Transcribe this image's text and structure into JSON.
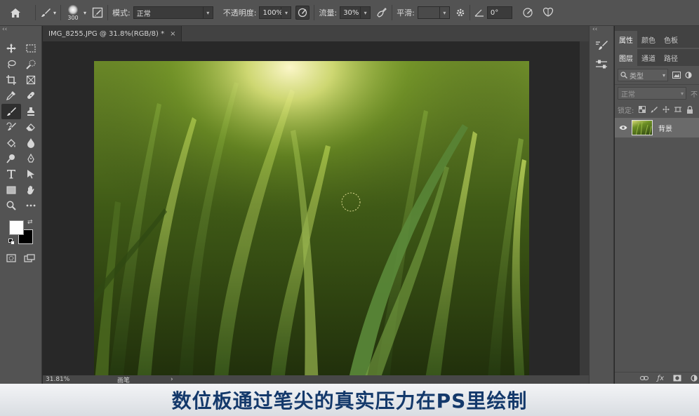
{
  "options_bar": {
    "brush_size": "300",
    "mode_label": "模式:",
    "mode_value": "正常",
    "opacity_label": "不透明度:",
    "opacity_value": "100%",
    "flow_label": "流量:",
    "flow_value": "30%",
    "smoothing_label": "平滑:",
    "angle_value": "0°"
  },
  "document": {
    "tab_title": "IMG_8255.JPG @ 31.8%(RGB/8) *",
    "close_glyph": "×",
    "zoom": "31.81%",
    "status_text": "画笔"
  },
  "panels": {
    "top_tabs": [
      "属性",
      "颜色",
      "色板"
    ],
    "layer_tabs": [
      "图层",
      "通道",
      "路径"
    ],
    "filter_kind": "类型",
    "blend_mode": "正常",
    "opacity_short": "不",
    "lock_label": "锁定:",
    "layers": [
      {
        "name": "背景"
      }
    ]
  },
  "subtitle": "数位板通过笔尖的真实压力在PS里绘制",
  "colors": {
    "foreground": "#ffffff",
    "background": "#000000",
    "subtitle_text": "#14396b"
  },
  "collapse_glyph": "‹‹"
}
